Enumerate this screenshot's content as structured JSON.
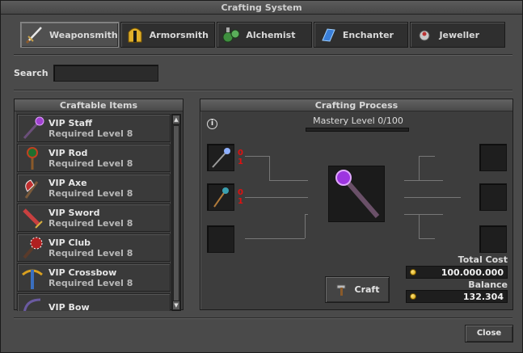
{
  "window": {
    "title": "Crafting System"
  },
  "tabs": [
    {
      "label": "Weaponsmith",
      "icon": "sword-icon",
      "active": true
    },
    {
      "label": "Armorsmith",
      "icon": "helmet-icon",
      "active": false
    },
    {
      "label": "Alchemist",
      "icon": "potion-icon",
      "active": false
    },
    {
      "label": "Enchanter",
      "icon": "crystal-icon",
      "active": false
    },
    {
      "label": "Jeweller",
      "icon": "gem-icon",
      "active": false
    }
  ],
  "search": {
    "label": "Search",
    "value": "",
    "placeholder": ""
  },
  "craftable": {
    "title": "Craftable Items",
    "items": [
      {
        "name": "VIP Staff",
        "requirement": "Required Level 8",
        "icon": "staff-icon"
      },
      {
        "name": "VIP Rod",
        "requirement": "Required Level 8",
        "icon": "rod-icon"
      },
      {
        "name": "VIP Axe",
        "requirement": "Required Level 8",
        "icon": "axe-icon"
      },
      {
        "name": "VIP Sword",
        "requirement": "Required Level 8",
        "icon": "sword-icon"
      },
      {
        "name": "VIP Club",
        "requirement": "Required Level 8",
        "icon": "club-icon"
      },
      {
        "name": "VIP Crossbow",
        "requirement": "Required Level 8",
        "icon": "crossbow-icon"
      },
      {
        "name": "VIP Bow",
        "requirement": "",
        "icon": "bow-icon"
      }
    ]
  },
  "process": {
    "title": "Crafting Process",
    "mastery": "Mastery Level 0/100",
    "mastery_fraction": 0,
    "ingredients": [
      {
        "icon": "material-icon-1",
        "have": "0",
        "need": "1"
      },
      {
        "icon": "material-icon-2",
        "have": "0",
        "need": "1"
      },
      {
        "icon": "empty-slot",
        "have": "",
        "need": ""
      }
    ],
    "result_icon": "staff-icon",
    "total_cost_label": "Total Cost",
    "total_cost": "100.000.000",
    "balance_label": "Balance",
    "balance": "132.304",
    "craft_label": "Craft"
  },
  "close_label": "Close",
  "colors": {
    "count_red": "#e01010",
    "coin": "#f2c12e"
  }
}
